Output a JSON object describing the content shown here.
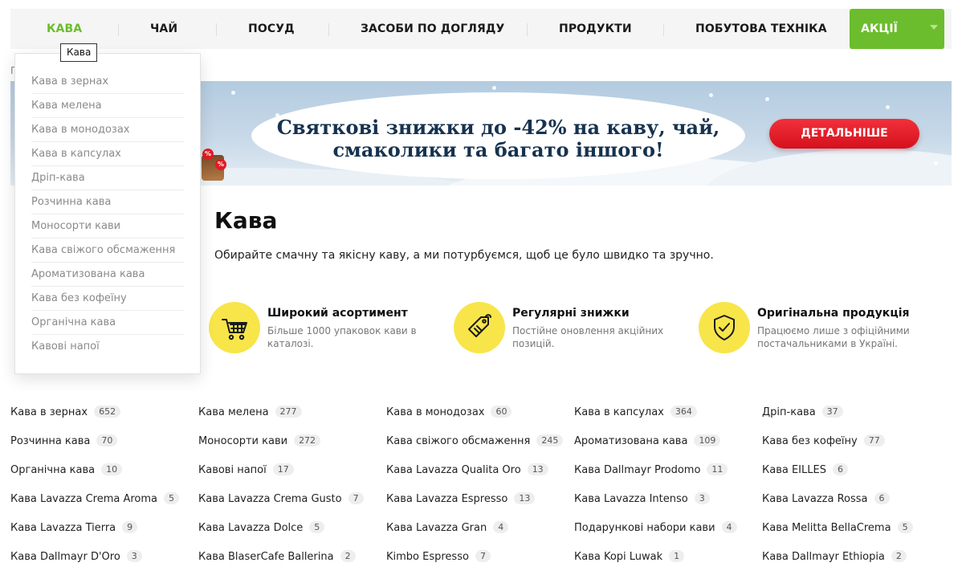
{
  "nav": {
    "items": [
      {
        "label": "Кава",
        "active": true
      },
      {
        "label": "Чай"
      },
      {
        "label": "Посуд"
      },
      {
        "label": "Засоби по догляду"
      },
      {
        "label": "Продукти"
      },
      {
        "label": "Побутова техніка"
      }
    ],
    "promo_label": "Акції"
  },
  "tooltip": "Кава",
  "breadcrumb_fragment": "Г",
  "dropdown": {
    "items": [
      "Кава в зернах",
      "Кава мелена",
      "Кава в монодозах",
      "Кава в капсулах",
      "Дріп-кава",
      "Розчинна кава",
      "Моносорти кави",
      "Кава свіжого обсмаження",
      "Ароматизована кава",
      "Кава без кофеїну",
      "Органічна кава",
      "Кавові напої"
    ]
  },
  "banner": {
    "line1": "Святкові знижки до -42% на каву, чай,",
    "line2": "смаколики та багато іншого!",
    "cta": "ДЕТАЛЬНІШЕ",
    "badge": "%"
  },
  "page": {
    "title": "Кава",
    "lead": "Обирайте смачну та якісну каву, а ми потурбуємся, щоб це було швидко та зручно."
  },
  "features": [
    {
      "icon": "cart-icon",
      "title": "Широкий асортимент",
      "text": "Більше 1000 упаковок кави в каталозі."
    },
    {
      "icon": "price-tag-icon",
      "title": "Регулярні знижки",
      "text": "Постійне оновлення акційних позицій."
    },
    {
      "icon": "shield-check-icon",
      "title": "Оригінальна продукція",
      "text": "Працюємо лише з офіційними постачальниками в Україні."
    }
  ],
  "categories": [
    {
      "name": "Кава в зернах",
      "count": "652"
    },
    {
      "name": "Кава мелена",
      "count": "277"
    },
    {
      "name": "Кава в монодозах",
      "count": "60"
    },
    {
      "name": "Кава в капсулах",
      "count": "364"
    },
    {
      "name": "Дріп-кава",
      "count": "37"
    },
    {
      "name": "Розчинна кава",
      "count": "70"
    },
    {
      "name": "Моносорти кави",
      "count": "272"
    },
    {
      "name": "Кава свіжого обсмаження",
      "count": "245"
    },
    {
      "name": "Ароматизована кава",
      "count": "109"
    },
    {
      "name": "Кава без кофеїну",
      "count": "77"
    },
    {
      "name": "Органічна кава",
      "count": "10"
    },
    {
      "name": "Кавові напої",
      "count": "17"
    },
    {
      "name": "Кава Lavazza Qualita Oro",
      "count": "13"
    },
    {
      "name": "Кава Dallmayr Prodomo",
      "count": "11"
    },
    {
      "name": "Кава EILLES",
      "count": "6"
    },
    {
      "name": "Кава Lavazza Crema Aroma",
      "count": "5"
    },
    {
      "name": "Кава Lavazza Crema Gusto",
      "count": "7"
    },
    {
      "name": "Кава Lavazza Espresso",
      "count": "13"
    },
    {
      "name": "Кава Lavazza Intenso",
      "count": "3"
    },
    {
      "name": "Кава Lavazza Rossa",
      "count": "6"
    },
    {
      "name": "Кава Lavazza Tierra",
      "count": "9"
    },
    {
      "name": "Кава Lavazza Dolce",
      "count": "5"
    },
    {
      "name": "Кава Lavazza Gran",
      "count": "4"
    },
    {
      "name": "Подарункові набори кави",
      "count": "4"
    },
    {
      "name": "Кава Melitta BellaCrema",
      "count": "5"
    },
    {
      "name": "Кава Dallmayr D'Oro",
      "count": "3"
    },
    {
      "name": "Кава BlaserCafe Ballerina",
      "count": "2"
    },
    {
      "name": "Kimbo Espresso",
      "count": "7"
    },
    {
      "name": "Кава Kopi Luwak",
      "count": "1"
    },
    {
      "name": "Кава Dallmayr Ethiopia",
      "count": "2"
    }
  ],
  "colors": {
    "accent": "#6bbd2d",
    "cta": "#e21b24",
    "feature_circle": "#f8e54a"
  }
}
